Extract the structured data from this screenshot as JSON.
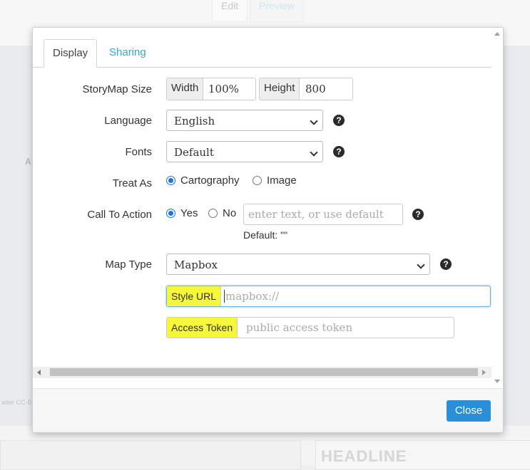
{
  "background": {
    "tabs": [
      "Edit",
      "Preview"
    ],
    "headline": "HEADLINE",
    "map_letter": "A",
    "map_credit": "ader CC-B"
  },
  "dialog": {
    "tabs": {
      "display": "Display",
      "sharing": "Sharing"
    },
    "storymap_size": {
      "label": "StoryMap Size",
      "width_label": "Width",
      "width_value": "100%",
      "height_label": "Height",
      "height_value": "800"
    },
    "language": {
      "label": "Language",
      "value": "English"
    },
    "fonts": {
      "label": "Fonts",
      "value": "Default"
    },
    "treat_as": {
      "label": "Treat As",
      "options": [
        "Cartography",
        "Image"
      ],
      "selected": "Cartography"
    },
    "call_to_action": {
      "label": "Call To Action",
      "options": [
        "Yes",
        "No"
      ],
      "selected": "Yes",
      "placeholder": "enter text, or use default",
      "default_hint": "Default: \"\""
    },
    "map_type": {
      "label": "Map Type",
      "value": "Mapbox"
    },
    "style_url": {
      "label": "Style URL",
      "placeholder": "mapbox://"
    },
    "access_token": {
      "label": "Access Token",
      "placeholder": "public access token"
    },
    "help_glyph": "?",
    "close_label": "Close"
  },
  "colors": {
    "accent": "#2a8fd6",
    "highlight": "#f7f73a",
    "tab_link": "#3aa6c6"
  }
}
